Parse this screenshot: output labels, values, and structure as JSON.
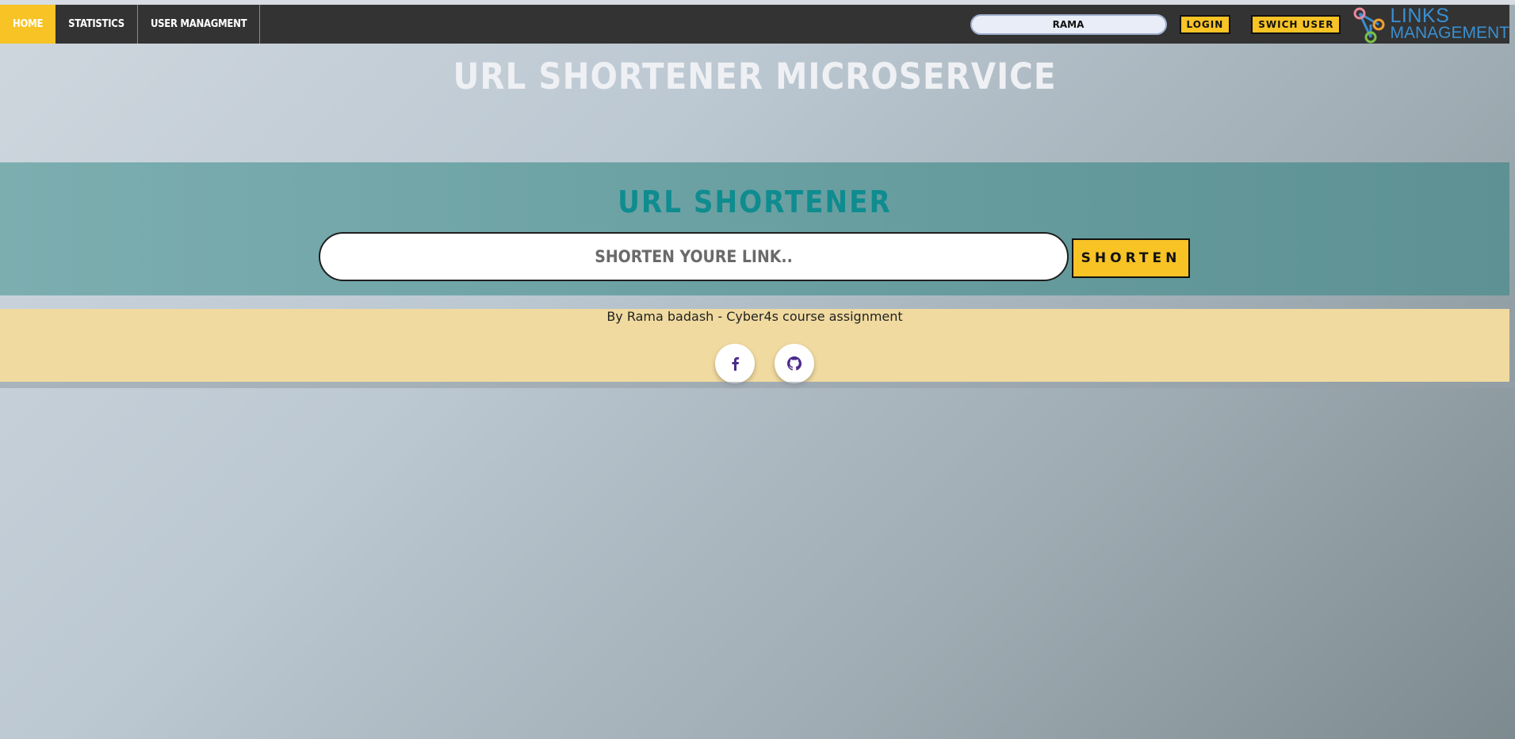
{
  "nav": {
    "items": [
      {
        "label": "Home",
        "active": true
      },
      {
        "label": "Statistics",
        "active": false
      },
      {
        "label": "User Managment",
        "active": false
      }
    ],
    "user_value": "RAMA",
    "login_label": "Login",
    "switch_label": "Swich User",
    "logo_line1": "LINKS",
    "logo_line2": "MANAGEMENT"
  },
  "page_title": "URL SHORTENER MICROSERVICE",
  "shortener": {
    "title": "URL SHORTENER",
    "input_placeholder": "SHORTEN YOURE LINK..",
    "button_label": "Shorten"
  },
  "footer": {
    "credit": "By Rama badash - Cyber4s course assignment",
    "icons": [
      "facebook-icon",
      "github-icon"
    ]
  },
  "colors": {
    "accent": "#f7c325",
    "navbar": "#333333",
    "band_title": "#0f8c8f",
    "footer_bg": "#f0daa0",
    "social_icon": "#4b2a8c"
  }
}
